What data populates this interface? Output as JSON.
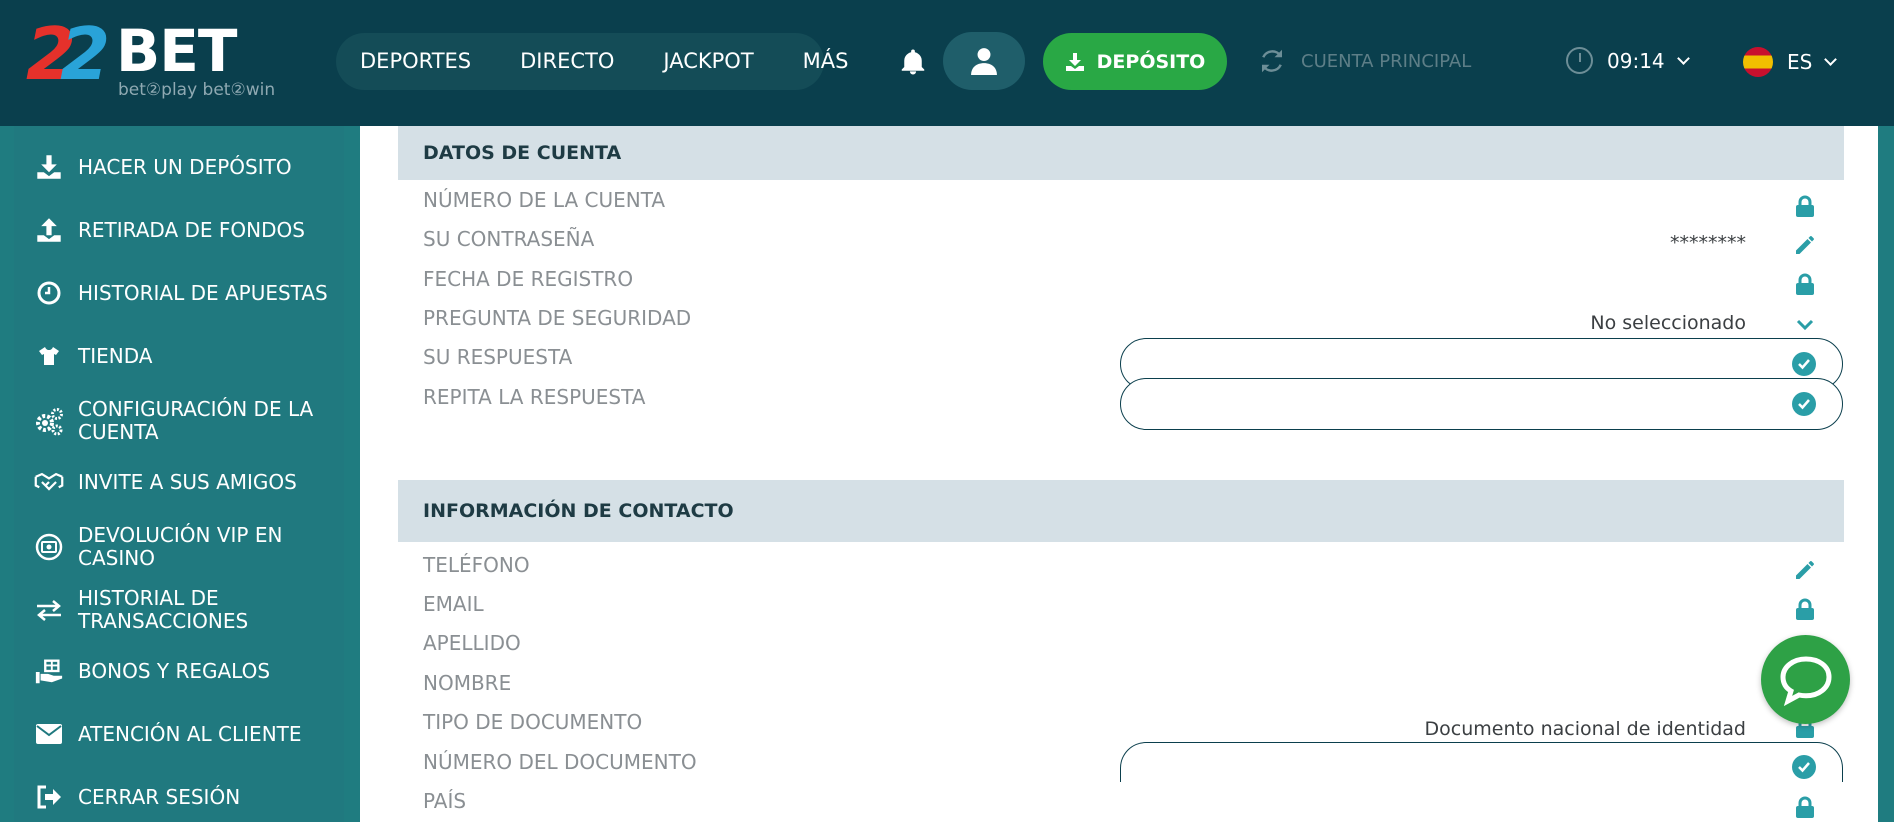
{
  "logo": {
    "num_a": "2",
    "num_b": "2",
    "word": "BET",
    "tagline": "bet②play  bet②win"
  },
  "nav": [
    {
      "label": "DEPORTES"
    },
    {
      "label": "DIRECTO"
    },
    {
      "label": "JACKPOT"
    },
    {
      "label": "MÁS"
    }
  ],
  "header": {
    "deposit_label": "DEPÓSITO",
    "account_label": "CUENTA PRINCIPAL",
    "time": "09:14",
    "language": "ES"
  },
  "sidebar": {
    "items": [
      {
        "label": "HACER UN DEPÓSITO",
        "icon": "download-icon"
      },
      {
        "label": "RETIRADA DE FONDOS",
        "icon": "upload-icon"
      },
      {
        "label": "HISTORIAL DE APUESTAS",
        "icon": "clock-icon"
      },
      {
        "label": "TIENDA",
        "icon": "tshirt-icon"
      },
      {
        "label": "CONFIGURACIÓN DE LA CUENTA",
        "icon": "gears-icon"
      },
      {
        "label": "INVITE A SUS AMIGOS",
        "icon": "handshake-icon"
      },
      {
        "label": "DEVOLUCIÓN VIP EN CASINO",
        "icon": "cashback-icon"
      },
      {
        "label": "HISTORIAL DE TRANSACCIONES",
        "icon": "transfer-icon"
      },
      {
        "label": "BONOS Y REGALOS",
        "icon": "gift-hand-icon"
      },
      {
        "label": "ATENCIÓN AL CLIENTE",
        "icon": "envelope-icon"
      },
      {
        "label": "CERRAR SESIÓN",
        "icon": "logout-icon"
      }
    ]
  },
  "account_section": {
    "title": "DATOS DE CUENTA",
    "rows": [
      {
        "label": "NÚMERO DE LA CUENTA",
        "value": ""
      },
      {
        "label": "SU CONTRASEÑA",
        "value": "********"
      },
      {
        "label": "FECHA DE REGISTRO",
        "value": ""
      },
      {
        "label": "PREGUNTA DE SEGURIDAD",
        "value": "No seleccionado"
      },
      {
        "label": "SU RESPUESTA",
        "value": ""
      },
      {
        "label": "REPITA LA RESPUESTA",
        "value": ""
      }
    ]
  },
  "contact_section": {
    "title": "INFORMACIÓN DE CONTACTO",
    "rows": [
      {
        "label": "TELÉFONO",
        "value": ""
      },
      {
        "label": "EMAIL",
        "value": ""
      },
      {
        "label": "APELLIDO",
        "value": ""
      },
      {
        "label": "NOMBRE",
        "value": ""
      },
      {
        "label": "TIPO DE DOCUMENTO",
        "value": "Documento nacional de identidad"
      },
      {
        "label": "NÚMERO DEL DOCUMENTO",
        "value": ""
      },
      {
        "label": "PAÍS",
        "value": ""
      }
    ]
  },
  "colors": {
    "header": "#0a3f4d",
    "sidebar": "#20797f",
    "accent": "#2a9ea7",
    "deposit": "#29a845",
    "chat": "#2ea146"
  }
}
